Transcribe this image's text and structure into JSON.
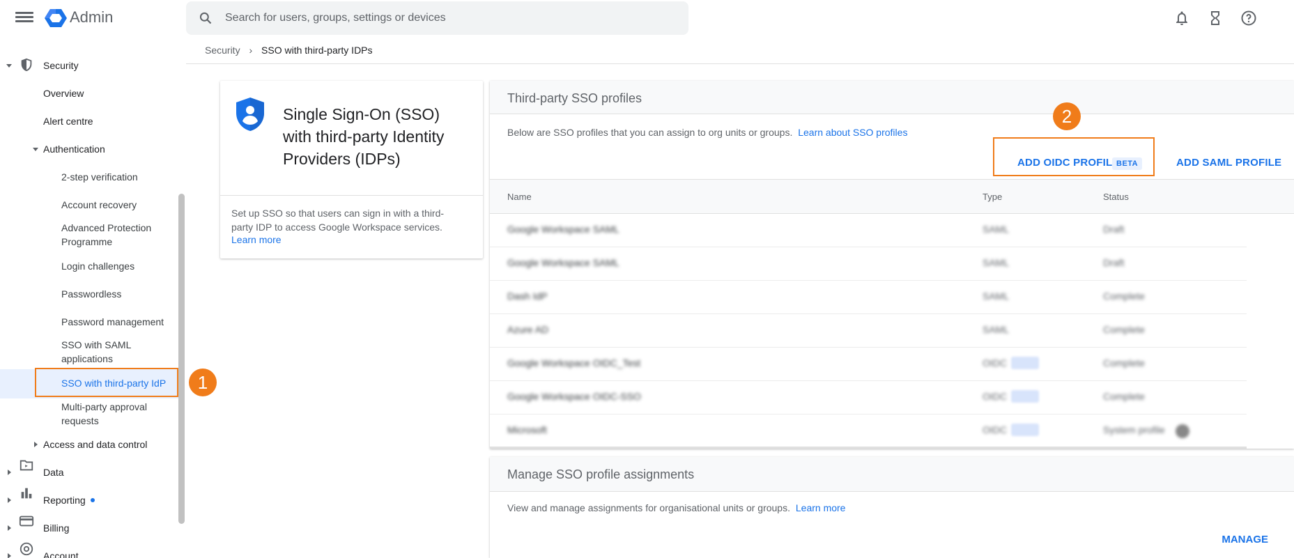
{
  "header": {
    "menu_icon": "hamburger-menu-icon",
    "logo_icon": "admin-hexagon-logo",
    "app_title": "Admin",
    "search_placeholder": "Search for users, groups, settings or devices",
    "icons": [
      "notifications-bell-icon",
      "tasks-hourglass-icon",
      "help-question-icon"
    ]
  },
  "breadcrumb": {
    "parent": "Security",
    "separator": "›",
    "current": "SSO with third-party IDPs"
  },
  "sidebar": {
    "security": "Security",
    "overview": "Overview",
    "alert_centre": "Alert centre",
    "authentication": "Authentication",
    "two_step": "2-step verification",
    "account_recovery": "Account recovery",
    "advanced_protection_1": "Advanced Protection",
    "advanced_protection_2": "Programme",
    "login_challenges": "Login challenges",
    "passwordless": "Passwordless",
    "password_management": "Password management",
    "sso_saml_1": "SSO with SAML",
    "sso_saml_2": "applications",
    "sso_third_party": "SSO with third-party IdP",
    "multi_party_1": "Multi-party approval",
    "multi_party_2": "requests",
    "access_data_control": "Access and data control",
    "data": "Data",
    "reporting": "Reporting",
    "billing": "Billing",
    "account": "Account"
  },
  "annotations": {
    "step1": "1",
    "step2": "2",
    "color": "#f07c1a"
  },
  "info_card": {
    "title": "Single Sign-On (SSO) with third-party Identity Providers (IDPs)",
    "description": "Set up SSO so that users can sign in with a third-party IDP to access Google Workspace services.",
    "link": "Learn more"
  },
  "profiles_panel": {
    "title": "Third-party SSO profiles",
    "description": "Below are SSO profiles that you can assign to org units or groups.",
    "learn_link": "Learn about SSO profiles",
    "add_oidc": "ADD OIDC PROFILE",
    "beta": "BETA",
    "add_saml": "ADD SAML PROFILE",
    "columns": [
      "Name",
      "Type",
      "Status"
    ],
    "rows": [
      {
        "name": "Google Workspace SAML",
        "type": "SAML",
        "status": "Draft",
        "beta": false
      },
      {
        "name": "Google Workspace SAML",
        "type": "SAML",
        "status": "Draft",
        "beta": false
      },
      {
        "name": "Dash IdP",
        "type": "SAML",
        "status": "Complete",
        "beta": false
      },
      {
        "name": "Azure AD",
        "type": "SAML",
        "status": "Complete",
        "beta": false
      },
      {
        "name": "Google Workspace OIDC_Test",
        "type": "OIDC",
        "status": "Complete",
        "beta": true
      },
      {
        "name": "Google Workspace OIDC-SSO",
        "type": "OIDC",
        "status": "Complete",
        "beta": true
      },
      {
        "name": "Microsoft",
        "type": "OIDC",
        "status": "System profile",
        "beta": true
      }
    ]
  },
  "assignments_panel": {
    "title": "Manage SSO profile assignments",
    "description": "View and manage assignments for organisational units or groups.",
    "learn_link": "Learn more",
    "manage": "MANAGE"
  },
  "colors": {
    "accent": "#1a73e8",
    "selected_bg": "#e8f0fe",
    "annotation": "#f07c1a"
  }
}
